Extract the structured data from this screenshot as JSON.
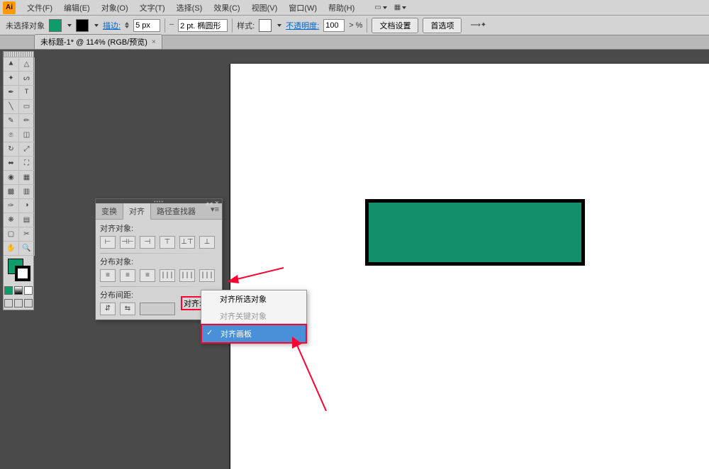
{
  "menubar": {
    "items": [
      "文件(F)",
      "编辑(E)",
      "对象(O)",
      "文字(T)",
      "选择(S)",
      "效果(C)",
      "视图(V)",
      "窗口(W)",
      "帮助(H)"
    ]
  },
  "controlbar": {
    "selection_label": "未选择对象",
    "stroke_label": "描边:",
    "stroke_value": "5 px",
    "stroke_pt": "2 pt. 椭圆形",
    "style_label": "样式:",
    "opacity_label": "不透明度:",
    "opacity_value": "100",
    "opacity_symbol": "> %",
    "doc_setup": "文档设置",
    "prefs": "首选项"
  },
  "tab": {
    "title": "未标题-1* @ 114% (RGB/预览)"
  },
  "panel": {
    "tabs": [
      "变换",
      "对齐",
      "路径查找器"
    ],
    "section1": "对齐对象:",
    "section2": "分布对象:",
    "section3": "分布间距:",
    "align_to_label": "对齐:"
  },
  "dropdown": {
    "items": [
      {
        "label": "对齐所选对象",
        "disabled": false,
        "selected": false
      },
      {
        "label": "对齐关键对象",
        "disabled": true,
        "selected": false
      },
      {
        "label": "对齐画板",
        "disabled": false,
        "selected": true
      }
    ]
  },
  "shape": {
    "fill": "#148f6b",
    "stroke": "#000000"
  }
}
